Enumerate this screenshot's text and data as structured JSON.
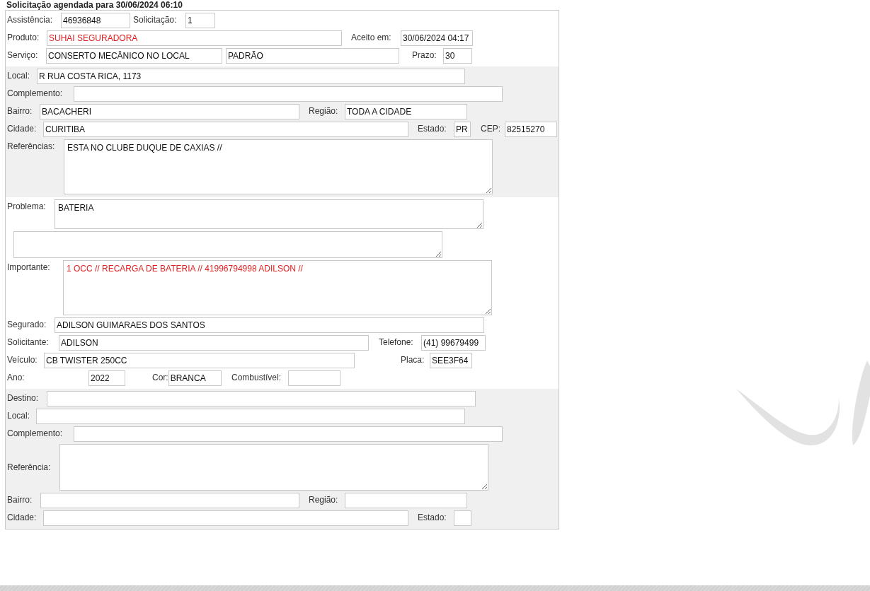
{
  "header": {
    "title": "Solicitação agendada para 30/06/2024 06:10"
  },
  "sections": [
    {
      "shaded": false,
      "rows": [
        {
          "items": [
            {
              "kind": "field",
              "label": "Assistência:",
              "value": "46936848",
              "highlighted": false
            },
            {
              "kind": "field",
              "label": "Solicitação:",
              "value": "1",
              "highlighted": false
            }
          ]
        },
        {
          "items": [
            {
              "kind": "field",
              "label": "Produto:",
              "value": "SUHAI SEGURADORA",
              "highlighted": true
            },
            {
              "kind": "field",
              "label": "Aceito em:",
              "value": "30/06/2024 04:17",
              "highlighted": false
            }
          ]
        },
        {
          "items": [
            {
              "kind": "field",
              "label": "Serviço:",
              "value": "CONSERTO MECÂNICO NO LOCAL",
              "highlighted": false
            },
            {
              "kind": "field",
              "value": "PADRÃO",
              "highlighted": false
            },
            {
              "kind": "field",
              "label": "Prazo:",
              "value": "30",
              "highlighted": false
            }
          ]
        }
      ]
    },
    {
      "shaded": true,
      "rows": [
        {
          "items": [
            {
              "kind": "field",
              "label": "Local:",
              "value": "R RUA COSTA RICA, 1173",
              "highlighted": false
            }
          ]
        },
        {
          "items": [
            {
              "kind": "field",
              "label": "Complemento:"
            }
          ]
        },
        {
          "items": [
            {
              "kind": "field",
              "label": "Bairro:",
              "value": "BACACHERI",
              "highlighted": false
            },
            {
              "kind": "field",
              "label": "Região:",
              "value": "TODA A CIDADE",
              "highlighted": false
            }
          ]
        },
        {
          "items": [
            {
              "kind": "field",
              "label": "Cidade:",
              "value": "CURITIBA",
              "highlighted": false
            },
            {
              "kind": "field",
              "label": "Estado:",
              "value": "PR",
              "highlighted": false
            },
            {
              "kind": "field",
              "label": "CEP:",
              "value": "82515270",
              "highlighted": false
            }
          ]
        },
        {
          "items": [
            {
              "kind": "textarea",
              "label": "Referências:",
              "value": "ESTA NO CLUBE DUQUE DE CAXIAS //",
              "highlighted": false
            }
          ]
        }
      ]
    },
    {
      "shaded": false,
      "rows": [
        {
          "items": [
            {
              "kind": "textarea",
              "label": "Problema:",
              "value": "BATERIA",
              "highlighted": false
            }
          ]
        },
        {
          "items": [
            {
              "kind": "textarea"
            }
          ]
        },
        {
          "items": [
            {
              "kind": "textarea",
              "label": "Importante:",
              "value": "1 OCC // RECARGA DE BATERIA // 41996794998 ADILSON //",
              "highlighted": true
            }
          ]
        },
        {
          "items": [
            {
              "kind": "field",
              "label": "Segurado:",
              "value": "ADILSON GUIMARAES DOS SANTOS",
              "highlighted": false
            }
          ]
        },
        {
          "items": [
            {
              "kind": "field",
              "label": "Solicitante:",
              "value": "ADILSON",
              "highlighted": false
            },
            {
              "kind": "field",
              "label": "Telefone:",
              "value": "(41) 99679499",
              "highlighted": false
            }
          ]
        },
        {
          "items": [
            {
              "kind": "field",
              "label": "Veículo:",
              "value": "CB TWISTER 250CC",
              "highlighted": false
            },
            {
              "kind": "field",
              "label": "Placa:",
              "value": "SEE3F64",
              "highlighted": false
            }
          ]
        },
        {
          "items": [
            {
              "kind": "field",
              "label": "Ano:",
              "value": "2022",
              "highlighted": false
            },
            {
              "kind": "field",
              "label": "Cor:",
              "value": "BRANCA",
              "highlighted": false
            },
            {
              "kind": "field",
              "label": "Combustível:"
            }
          ]
        }
      ]
    },
    {
      "shaded": true,
      "rows": [
        {
          "items": [
            {
              "kind": "field",
              "label": "Destino:"
            }
          ]
        },
        {
          "items": [
            {
              "kind": "field",
              "label": "Local:"
            }
          ]
        },
        {
          "items": [
            {
              "kind": "field",
              "label": "Complemento:"
            }
          ]
        },
        {
          "items": [
            {
              "kind": "textarea",
              "label": "Referência:"
            }
          ]
        },
        {
          "items": [
            {
              "kind": "field",
              "label": "Bairro:"
            },
            {
              "kind": "field",
              "label": "Região:"
            }
          ]
        },
        {
          "items": [
            {
              "kind": "field",
              "label": "Cidade:"
            },
            {
              "kind": "field",
              "label": "Estado:"
            }
          ]
        }
      ]
    }
  ]
}
